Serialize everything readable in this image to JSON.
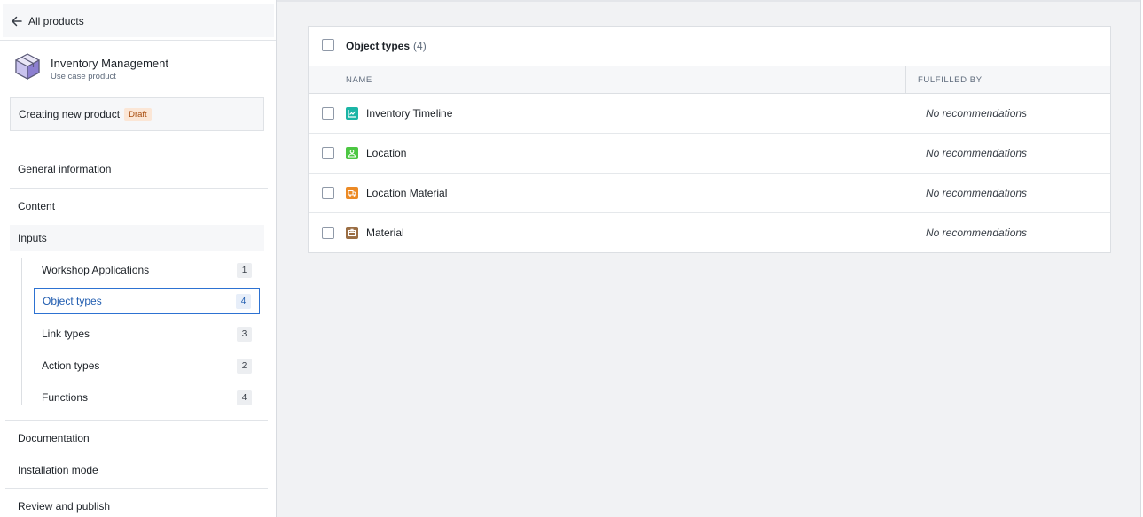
{
  "sidebar": {
    "back_label": "All products",
    "product": {
      "title": "Inventory Management",
      "subtitle": "Use case product",
      "icon": "cube-icon"
    },
    "status": {
      "text": "Creating new product",
      "tag": "Draft"
    },
    "nav": {
      "general": "General information",
      "content": "Content",
      "inputs": "Inputs",
      "documentation": "Documentation",
      "installation": "Installation mode",
      "review": "Review and publish"
    },
    "inputs_children": [
      {
        "label": "Workshop Applications",
        "count": "1"
      },
      {
        "label": "Object types",
        "count": "4"
      },
      {
        "label": "Link types",
        "count": "3"
      },
      {
        "label": "Action types",
        "count": "2"
      },
      {
        "label": "Functions",
        "count": "4"
      }
    ]
  },
  "panel": {
    "title": "Object types",
    "count": "(4)",
    "columns": {
      "name": "NAME",
      "fulfilled_by": "FULFILLED BY"
    },
    "rows": [
      {
        "name": "Inventory Timeline",
        "fulfilled": "No recommendations",
        "icon": "timeline-chart-icon",
        "color": "#1bb5a6"
      },
      {
        "name": "Location",
        "fulfilled": "No recommendations",
        "icon": "location-person-icon",
        "color": "#4cc742"
      },
      {
        "name": "Location Material",
        "fulfilled": "No recommendations",
        "icon": "truck-icon",
        "color": "#ec8a25"
      },
      {
        "name": "Material",
        "fulfilled": "No recommendations",
        "icon": "box-icon",
        "color": "#9a6d43"
      }
    ]
  },
  "colors": {
    "accent": "#2d72d2",
    "draft_bg": "#fbe6d6",
    "draft_fg": "#a84b0c"
  }
}
